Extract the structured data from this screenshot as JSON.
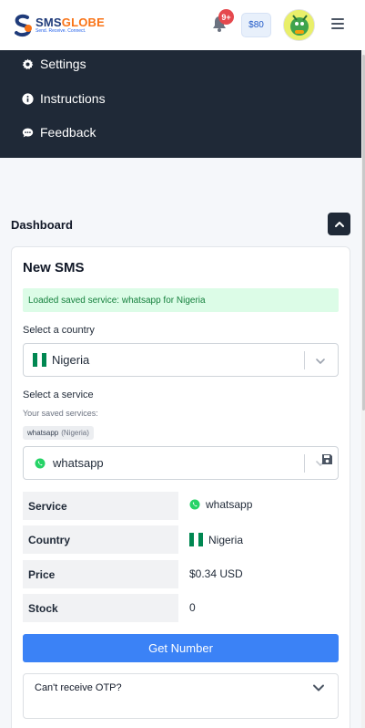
{
  "header": {
    "logo_sms": "SMS",
    "logo_globe": "GLOBE",
    "logo_tagline": "Send. Receive. Connect.",
    "notification_badge": "9+",
    "balance": "$80",
    "icons": {
      "bell": "bell-icon",
      "menu": "hamburger-menu-icon",
      "avatar": "user-avatar"
    }
  },
  "menu": {
    "items": [
      {
        "label": "Settings",
        "icon": "gear-icon"
      },
      {
        "label": "Instructions",
        "icon": "info-circle-icon"
      },
      {
        "label": "Feedback",
        "icon": "comment-icon"
      }
    ]
  },
  "dashboard": {
    "title": "Dashboard",
    "collapse_icon": "chevron-up-icon"
  },
  "card": {
    "title": "New SMS",
    "alert": "Loaded saved service: whatsapp for Nigeria",
    "country_label": "Select a country",
    "country_value": "Nigeria",
    "service_label": "Select a service",
    "saved_services_label": "Your saved services:",
    "saved_chip_service": "whatsapp",
    "saved_chip_country": "(Nigeria)",
    "service_value": "whatsapp",
    "save_icon": "save-icon"
  },
  "details": {
    "rows": [
      {
        "key": "Service",
        "value": "whatsapp"
      },
      {
        "key": "Country",
        "value": "Nigeria"
      },
      {
        "key": "Price",
        "value": "$0.34 USD"
      },
      {
        "key": "Stock",
        "value": "0"
      }
    ]
  },
  "actions": {
    "get_number": "Get Number",
    "otp_question": "Can't receive OTP?"
  },
  "colors": {
    "dark_nav": "#1f2937",
    "primary": "#3b82f6",
    "alert_bg": "#dcfce7",
    "alert_text": "#15803d",
    "nigeria_green": "#008751",
    "whatsapp_green": "#25d366",
    "badge_red": "#e5484d"
  }
}
